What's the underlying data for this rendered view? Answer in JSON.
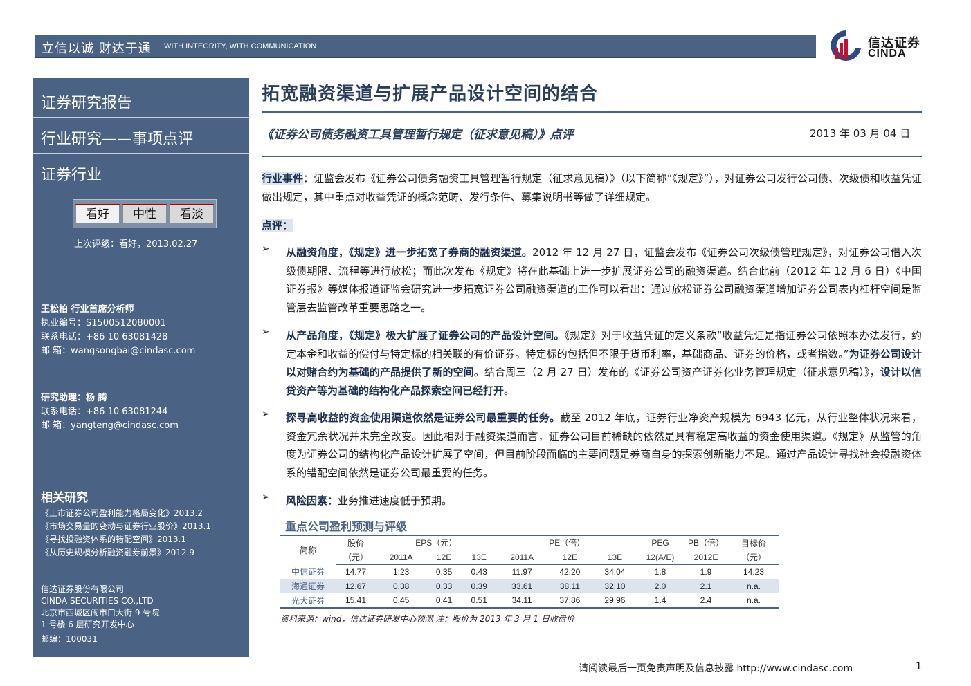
{
  "header": {
    "slogan_cn": "立信以诚  财达于通",
    "slogan_en": "WITH INTEGRITY, WITH COMMUNICATION",
    "logo_cn": "信达证券",
    "logo_en": "CINDA"
  },
  "sidebar": {
    "report_type": "证券研究报告",
    "report_subtype": "行业研究——事项点评",
    "industry": "证券行业",
    "ratings": [
      "看好",
      "中性",
      "看淡"
    ],
    "last_rating": "上次评级：看好，2013.02.27",
    "analyst": {
      "name": "王松柏   行业首席分析师",
      "license": "执业编号：S1500512080001",
      "phone": "联系电话：+86 10 63081428",
      "email_label": "邮    箱：",
      "email": "wangsongbai@cindasc.com"
    },
    "assistant": {
      "name": "研究助理：杨 腾",
      "phone": "联系电话：+86 10 63081244",
      "email_label": "邮    箱：",
      "email": "yangteng@cindasc.com"
    },
    "related_title": "相关研究",
    "related": [
      "《上市证券公司盈利能力格局变化》2013.2",
      "《市场交易量的变动与证券行业股价》2013.1",
      "《寻找投融资体系的错配空间》2013.1",
      "《从历史规模分析融资融券前景》2012.9"
    ],
    "company": {
      "name_cn": "信达证券股份有限公司",
      "name_en": "CINDA SECURITIES CO.,LTD",
      "address1": "北京市西城区闹市口大街 9 号院",
      "address2": "1 号楼 6 层研究开发中心",
      "postcode": "邮编：100031"
    }
  },
  "main": {
    "title": "拓宽融资渠道与扩展产品设计空间的结合",
    "subtitle": "《证券公司债务融资工具管理暂行规定（征求意见稿）》点评",
    "date": "2013 年 03 月 04 日",
    "event_label": "行业事件",
    "event_text": "：证监会发布《证券公司债务融资工具管理暂行规定（征求意见稿）》（以下简称“《规定》”），对证券公司发行公司债、次级债和收益凭证做出规定，其中重点对收益凭证的概念范畴、发行条件、募集说明书等做了详细规定。",
    "comment_label": "点评：",
    "bullets": [
      {
        "bold": "从融资角度，《规定》进一步拓宽了券商的融资渠道。",
        "text": "2012 年 12 月 27 日，证监会发布《证券公司次级债管理规定》，对证券公司借入次级债期限、流程等进行放松；而此次发布《规定》将在此基础上进一步扩展证券公司的融资渠道。结合此前（2012 年 12 月 6 日）《中国证券报》等媒体报道证监会研究进一步拓宽证券公司融资渠道的工作可以看出：通过放松证券公司融资渠道增加证券公司表内杠杆空间是监管层去监管改革重要思路之一。"
      },
      {
        "bold": "从产品角度，《规定》极大扩展了证券公司的产品设计空间。",
        "text": "《规定》对于收益凭证的定义条款“收益凭证是指证券公司依照本办法发行，约定本金和收益的偿付与特定标的相关联的有价证券。特定标的包括但不限于货币利率，基础商品、证券的价格，或者指数。”",
        "bold2": "为证券公司设计以对赌合约为基础的产品提供了新的空间",
        "text2": "。结合周三（2 月 27 日）发布的《证券公司资产证券化业务管理规定（征求意见稿）》，",
        "bold3": "设计以信贷资产等为基础的结构化产品探索空间已经打开",
        "text3": "。"
      },
      {
        "bold": "探寻高收益的资金使用渠道依然是证券公司最重要的任务。",
        "text": "截至 2012 年底，证券行业净资产规模为 6943 亿元，从行业整体状况来看，资金冗余状况并未完全改变。因此相对于融资渠道而言，证券公司目前稀缺的依然是具有稳定高收益的资金使用渠道。《规定》从监管的角度为证券公司的结构化产品设计扩展了空间，但目前阶段面临的主要问题是券商自身的探索创新能力不足。通过产品设计寻找社会投融资体系的错配空间依然是证券公司最重要的任务。"
      },
      {
        "bold": "风险因素：",
        "text": "业务推进速度低于预期。"
      }
    ]
  },
  "table": {
    "title": "重点公司盈利预测与评级",
    "header_row1": [
      "简称",
      "股价",
      "EPS（元）",
      "PE（倍）",
      "PEG",
      "PB（倍）",
      "目标价"
    ],
    "header_row2": [
      "（元）",
      "2011A",
      "12E",
      "13E",
      "2011A",
      "12E",
      "13E",
      "12(A/E)",
      "2012E",
      "（元）"
    ],
    "rows": [
      [
        "中信证券",
        "14.77",
        "1.23",
        "0.35",
        "0.43",
        "11.97",
        "42.20",
        "34.04",
        "1.8",
        "1.9",
        "14.23"
      ],
      [
        "海通证券",
        "12.67",
        "0.38",
        "0.33",
        "0.39",
        "33.61",
        "38.11",
        "32.10",
        "2.0",
        "2.1",
        "n.a."
      ],
      [
        "光大证券",
        "15.41",
        "0.45",
        "0.41",
        "0.51",
        "34.11",
        "37.86",
        "29.96",
        "1.4",
        "2.4",
        "n.a."
      ]
    ],
    "note": "资料来源：wind，信达证券研发中心预测        注：股价为 2013 年 3 月 1 日收盘价"
  },
  "footer": {
    "disclaimer": "请阅读最后一页免责声明及信息披露 http://www.cindasc.com",
    "page": "1"
  }
}
